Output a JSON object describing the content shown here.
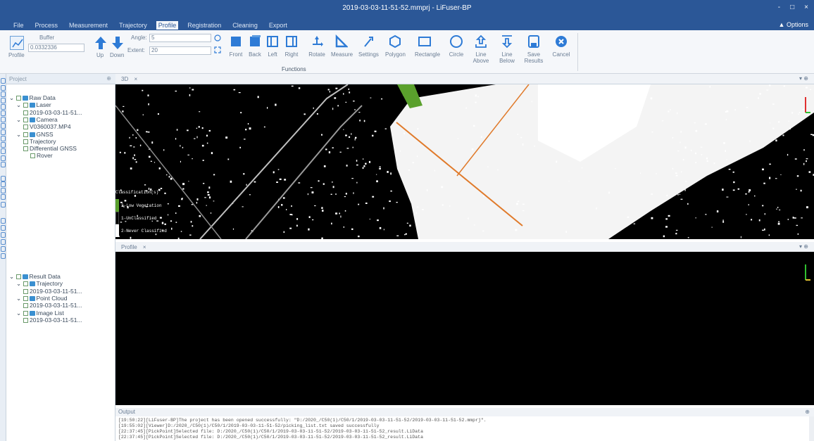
{
  "app": {
    "title": "2019-03-03-11-51-52.mmprj - LiFuser-BP",
    "options_label": "Options",
    "window_controls": [
      "-",
      "□",
      "×"
    ]
  },
  "menu": [
    {
      "label": "File",
      "active": false
    },
    {
      "label": "Process",
      "active": false
    },
    {
      "label": "Measurement",
      "active": false
    },
    {
      "label": "Trajectory",
      "active": false
    },
    {
      "label": "Profile",
      "active": true
    },
    {
      "label": "Registration",
      "active": false
    },
    {
      "label": "Cleaning",
      "active": false
    },
    {
      "label": "Export",
      "active": false
    }
  ],
  "ribbon": {
    "profile_label": "Profile",
    "buffer_label": "Buffer",
    "buffer_value": "0.0332336",
    "up_label": "Up",
    "down_label": "Down",
    "angle_label": "Angle:",
    "angle_value": "5",
    "extent_label": "Extent:",
    "extent_value": "20",
    "group_label": "Functions",
    "tools": [
      {
        "label": "Front",
        "icon": "front-view-icon"
      },
      {
        "label": "Back",
        "icon": "back-view-icon"
      },
      {
        "label": "Left",
        "icon": "left-view-icon"
      },
      {
        "label": "Right",
        "icon": "right-view-icon"
      },
      {
        "label": "Rotate",
        "icon": "rotate-icon"
      },
      {
        "label": "Measure",
        "icon": "measure-icon"
      },
      {
        "label": "Settings",
        "icon": "settings-icon"
      },
      {
        "label": "Polygon",
        "icon": "polygon-icon"
      },
      {
        "label": "Rectangle",
        "icon": "rectangle-icon"
      },
      {
        "label": "Circle",
        "icon": "circle-icon"
      },
      {
        "label": "Line\nAbove",
        "icon": "line-above-icon"
      },
      {
        "label": "Line\nBelow",
        "icon": "line-below-icon"
      },
      {
        "label": "Save\nResults",
        "icon": "save-icon"
      },
      {
        "label": "Cancel",
        "icon": "cancel-icon"
      }
    ]
  },
  "project": {
    "header": "Project",
    "raw_tree": [
      {
        "label": "Raw Data",
        "level": 0,
        "icon": "database-icon"
      },
      {
        "label": "Laser",
        "level": 1,
        "icon": "laser-icon"
      },
      {
        "label": "2019-03-03-11-51...",
        "level": 2,
        "icon": ""
      },
      {
        "label": "Camera",
        "level": 1,
        "icon": "camera-icon"
      },
      {
        "label": "V0360037.MP4",
        "level": 2,
        "icon": ""
      },
      {
        "label": "GNSS",
        "level": 1,
        "icon": "gnss-icon"
      },
      {
        "label": "Trajectory",
        "level": 2,
        "icon": ""
      },
      {
        "label": "Differential GNSS",
        "level": 2,
        "icon": ""
      },
      {
        "label": "Rover",
        "level": 3,
        "icon": ""
      }
    ],
    "result_tree": [
      {
        "label": "Result Data",
        "level": 0,
        "icon": "database-icon"
      },
      {
        "label": "Trajectory",
        "level": 1,
        "icon": "trajectory-icon"
      },
      {
        "label": "2019-03-03-11-51...",
        "level": 2,
        "icon": ""
      },
      {
        "label": "Point Cloud",
        "level": 1,
        "icon": "point-cloud-icon"
      },
      {
        "label": "2019-03-03-11-51...",
        "level": 2,
        "icon": ""
      },
      {
        "label": "Image List",
        "level": 1,
        "icon": "image-list-icon"
      },
      {
        "label": "2019-03-03-11-51...",
        "level": 2,
        "icon": ""
      }
    ]
  },
  "view3d": {
    "tab": "3D",
    "legend_title": "Classification(s)",
    "legend": [
      {
        "label": "3-Low Vegetation",
        "color": "#5aa02c"
      },
      {
        "label": "1-UnClassified",
        "color": "#000000"
      },
      {
        "label": "2-Never Classified",
        "color": "#ffffff"
      }
    ]
  },
  "profile": {
    "tab": "Profile"
  },
  "output": {
    "header": "Output",
    "lines": [
      "[19:50:22][LiFuser-BP]The project has been opened successfully: \"D:/2020_/C50(1)/C50/1/2019-03-03-11-51-52/2019-03-03-11-51-52.mmprj\".",
      "[19:55:02][Viewer]D:/2020_/C50(1)/C50/1/2019-03-03-11-51-52/picking_list.txt saved successfully",
      "[22:37:45][PickPoint]Selected file: D:/2020_/C50(1)/C50/1/2019-03-03-11-51-52/2019-03-03-11-51-52_result.LiData",
      "[22:37:45][PickPoint]Selected file: D:/2020_/C50(1)/C50/1/2019-03-03-11-51-52/2019-03-03-11-51-52_result.LiData"
    ]
  },
  "colors": {
    "titlebar": "#2b5797",
    "ribbon_icon": "#2e7bd6",
    "profile_line": "#e07a2a"
  }
}
